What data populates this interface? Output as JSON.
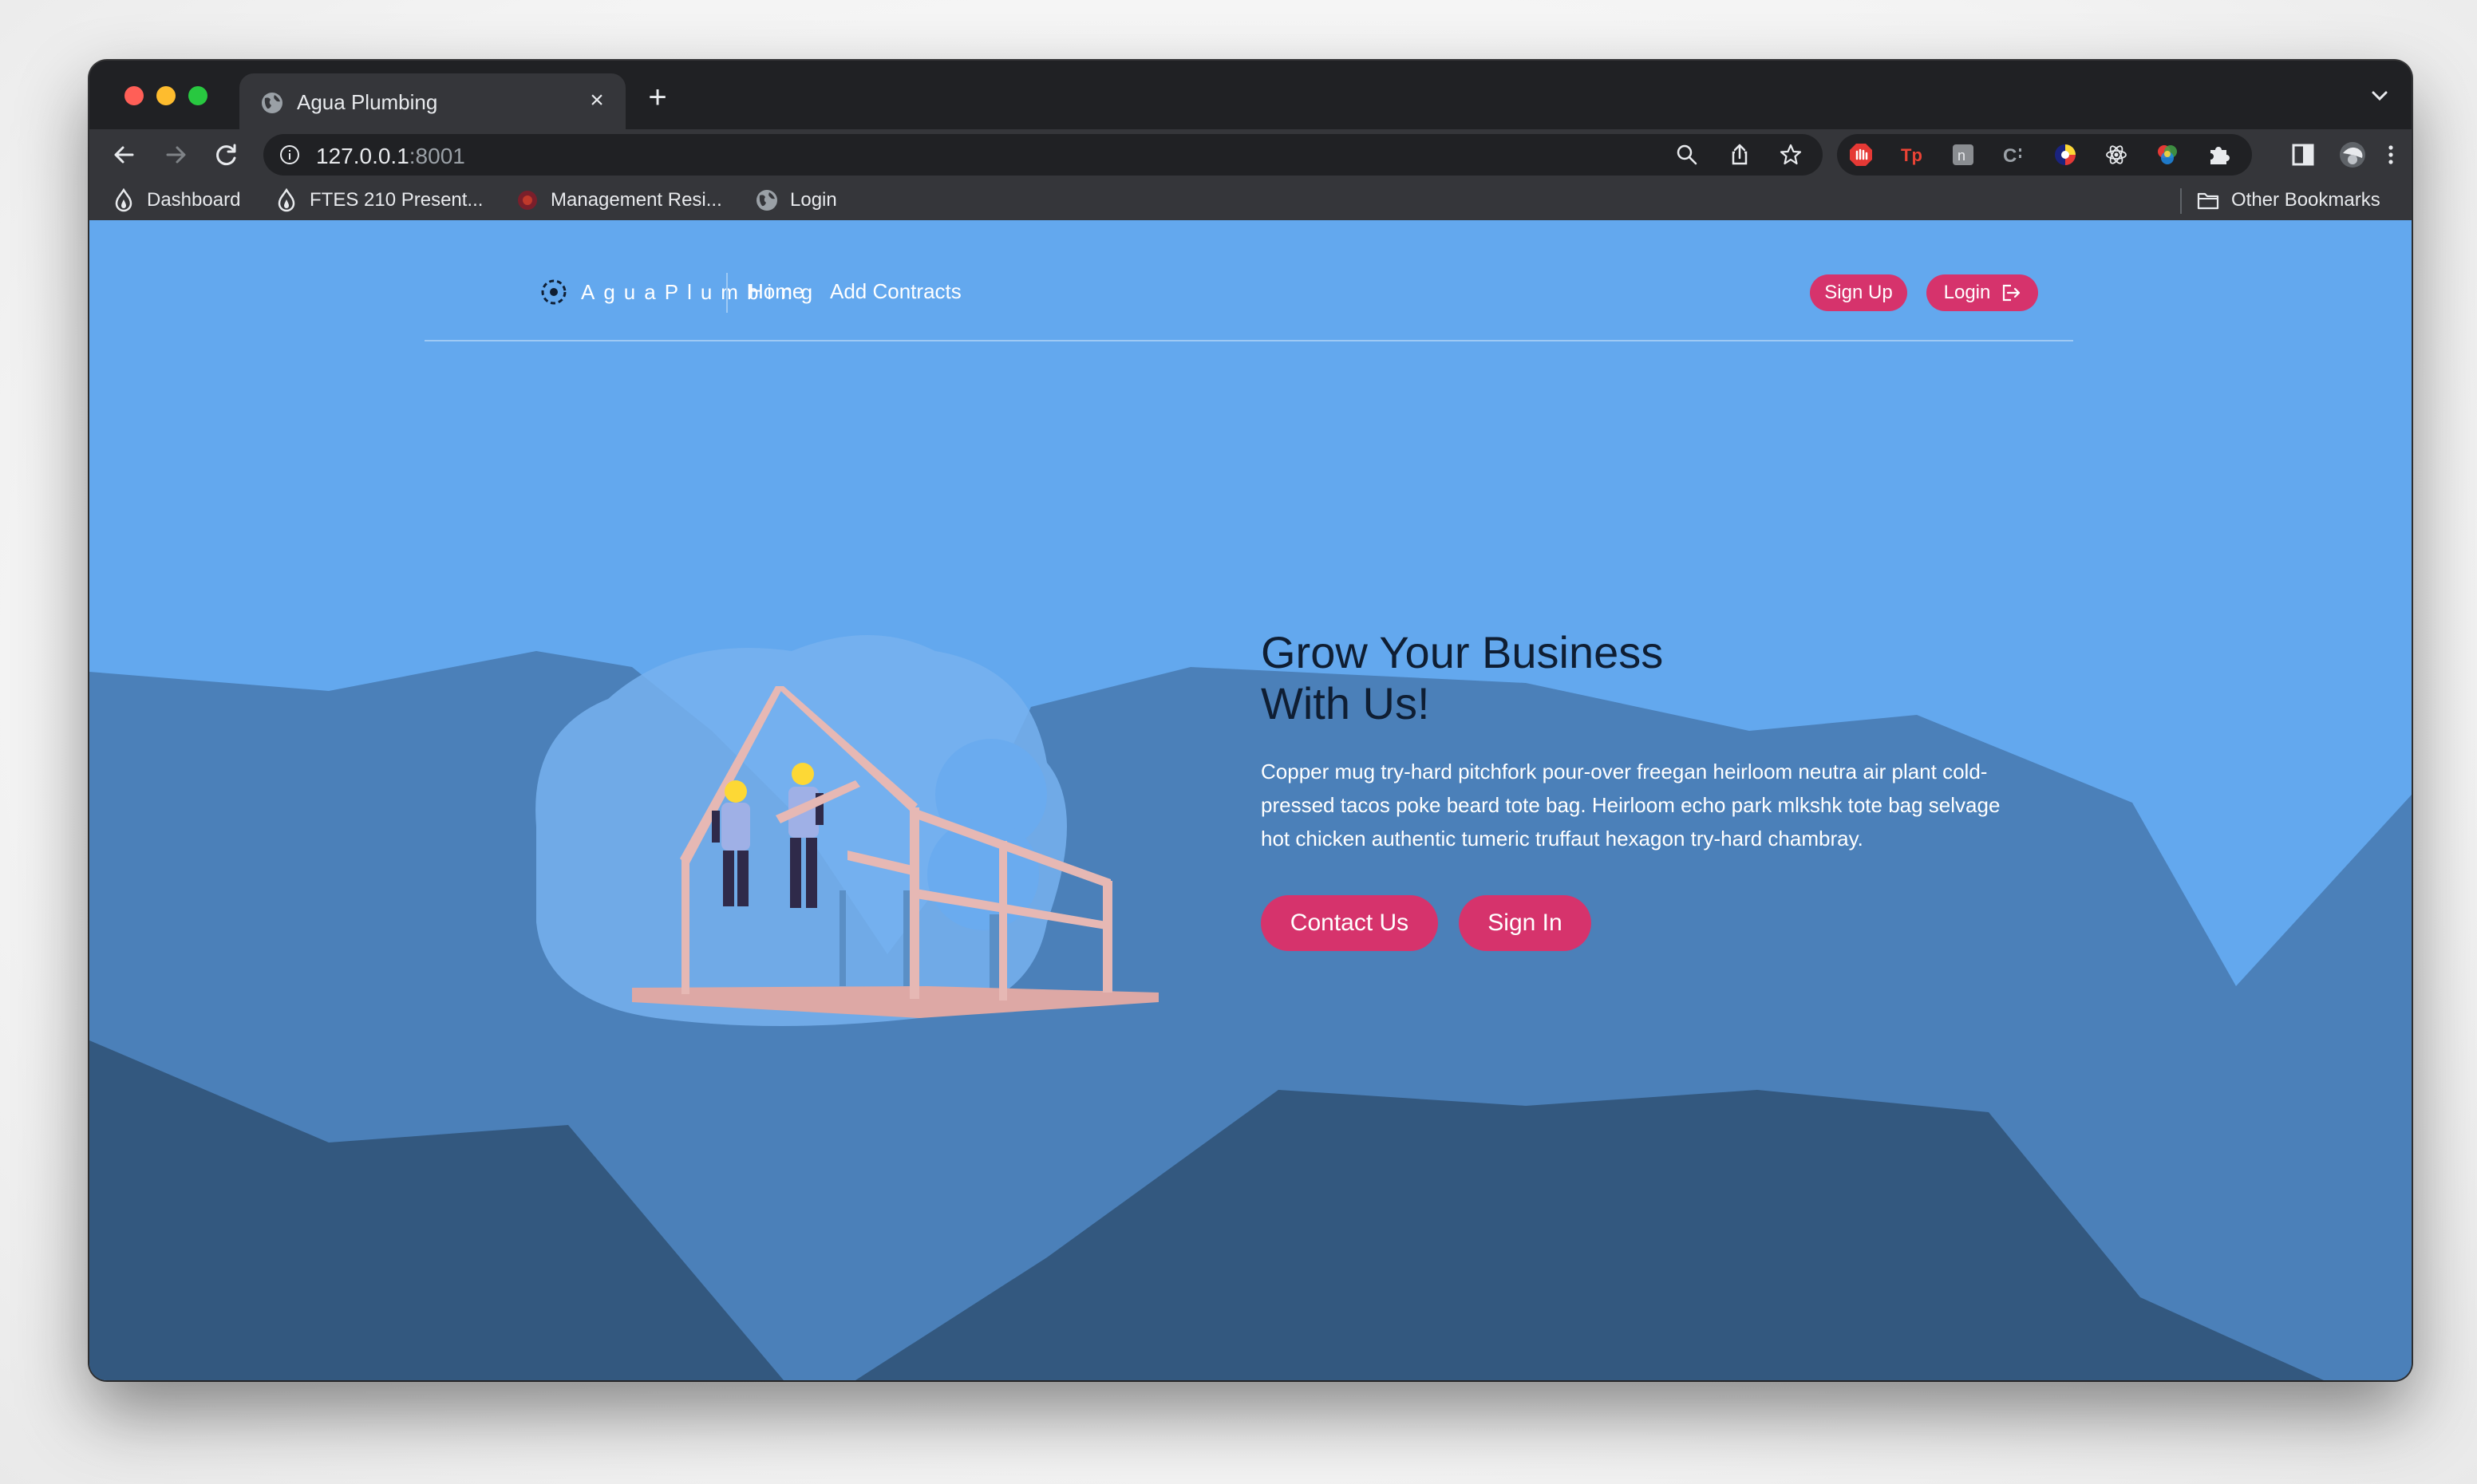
{
  "browser": {
    "tab_title": "Agua Plumbing",
    "tab_close": "×",
    "new_tab": "+",
    "url_host": "127.0.0.1",
    "url_port": ":8001",
    "bookmarks": [
      {
        "label": "Dashboard"
      },
      {
        "label": "FTES 210 Present..."
      },
      {
        "label": "Management Resi..."
      },
      {
        "label": "Login"
      }
    ],
    "other_bookmarks": "Other Bookmarks"
  },
  "site": {
    "brand": "AguaPlumbing",
    "nav_links": [
      "Home",
      "Add Contracts"
    ],
    "signup_label": "Sign Up",
    "login_label": "Login",
    "hero_title_line1": "Grow Your Business",
    "hero_title_line2": "With Us!",
    "hero_text": "Copper mug try-hard pitchfork pour-over freegan heirloom neutra air plant cold-pressed tacos poke beard tote bag. Heirloom echo park mlkshk tote bag selvage hot chicken authentic tumeric truffaut hexagon try-hard chambray.",
    "contact_label": "Contact Us",
    "signin_label": "Sign In"
  },
  "colors": {
    "page_bg": "#63a8ee",
    "mountain_mid": "#4a7fb8",
    "mountain_dark": "#345880",
    "accent": "#d6336c",
    "heading": "#0f1e33"
  }
}
